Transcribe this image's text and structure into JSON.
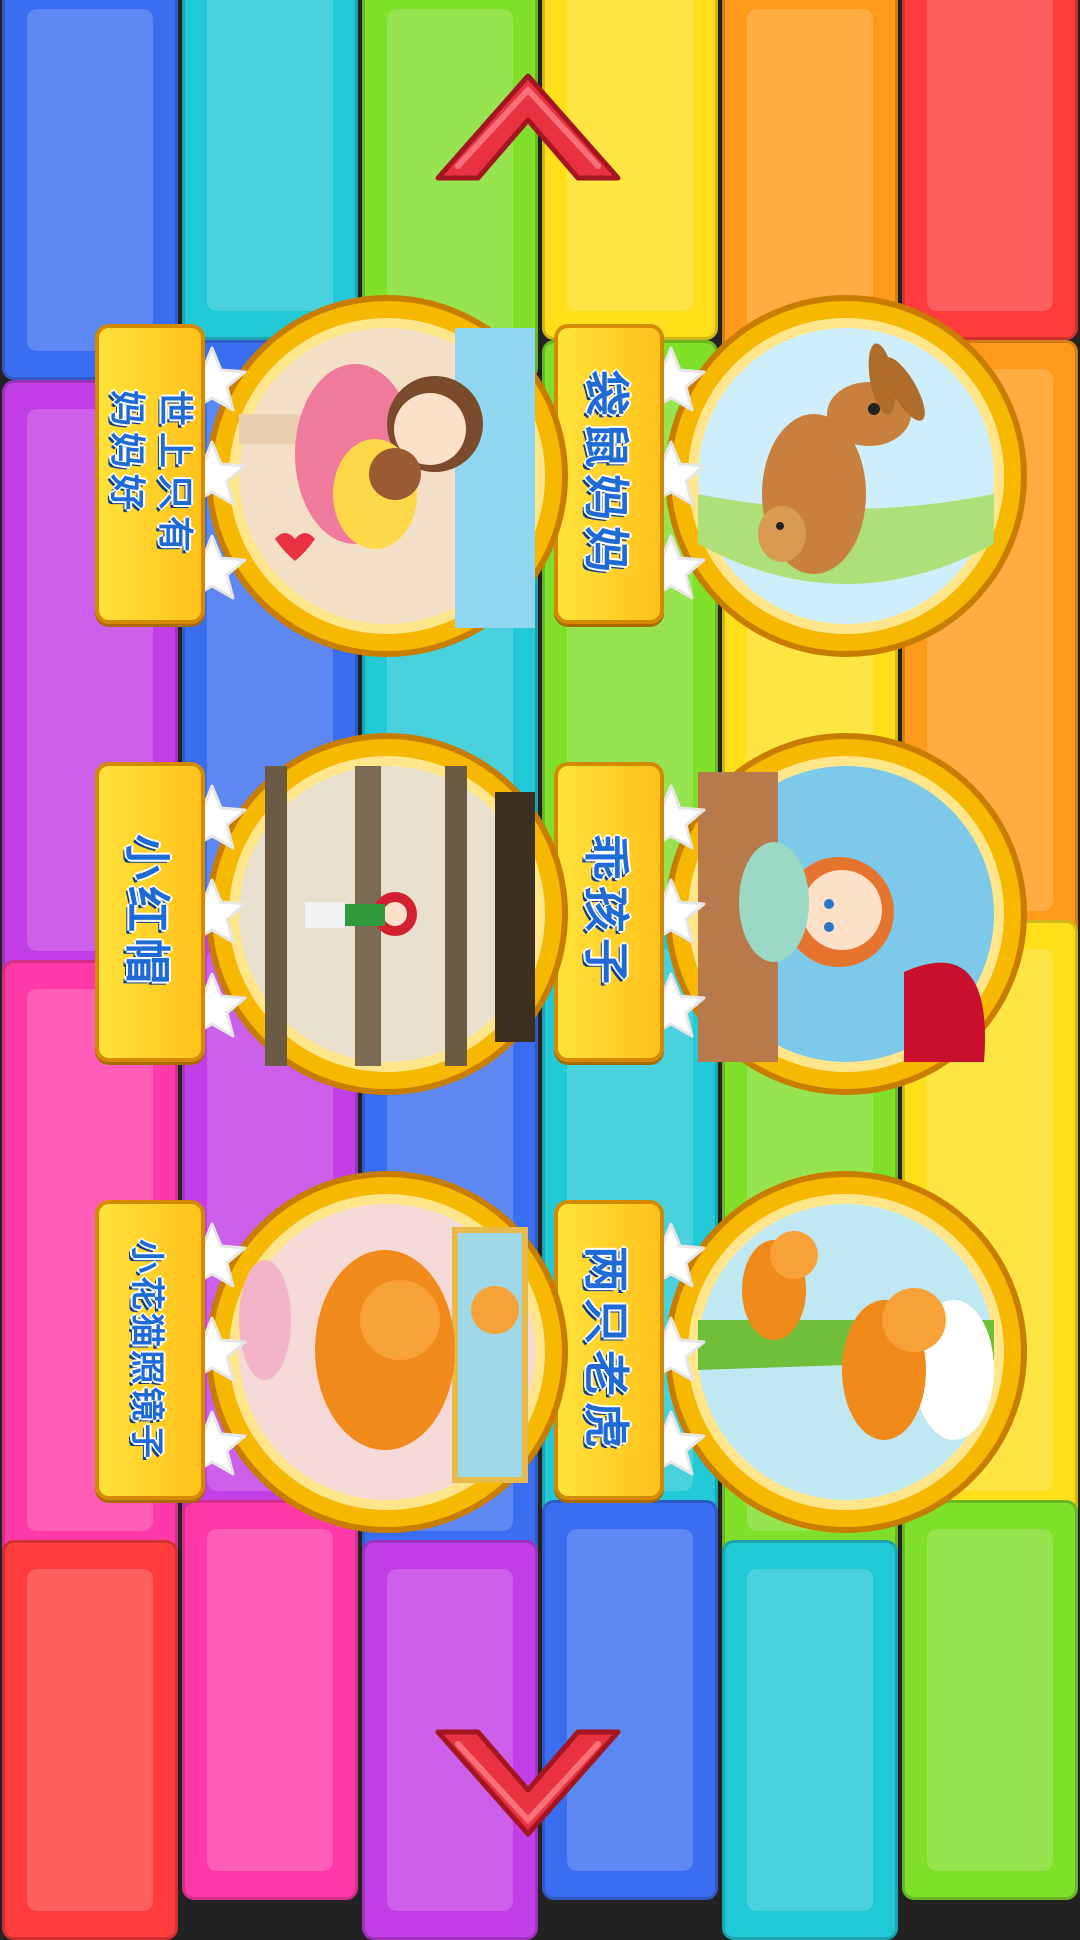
{
  "navigation": {
    "up_arrow_icon": "chevron-up-icon",
    "down_arrow_icon": "chevron-down-icon",
    "arrow_color": "#e8323f"
  },
  "songs": [
    {
      "title": "袋鼠妈妈",
      "stars_earned": 3,
      "stars_total": 3,
      "picture": "kangaroo-mother-with-joey"
    },
    {
      "title": "世上只有\n妈妈好",
      "stars_earned": 3,
      "stars_total": 3,
      "picture": "mother-hugging-child"
    },
    {
      "title": "乖孩子",
      "stars_earned": 3,
      "stars_total": 3,
      "picture": "girl-writing-at-desk"
    },
    {
      "title": "小红帽",
      "stars_earned": 3,
      "stars_total": 3,
      "picture": "little-red-riding-hood-in-forest"
    },
    {
      "title": "两只老虎",
      "stars_earned": 3,
      "stars_total": 3,
      "picture": "two-tigers"
    },
    {
      "title": "小花猫照镜子",
      "stars_earned": 3,
      "stars_total": 3,
      "picture": "orange-cat-at-mirror"
    }
  ],
  "colors": {
    "medallion_gold": "#f6b800",
    "label_yellow": "#ffd21f",
    "label_text_blue": "#1f6bd6"
  }
}
